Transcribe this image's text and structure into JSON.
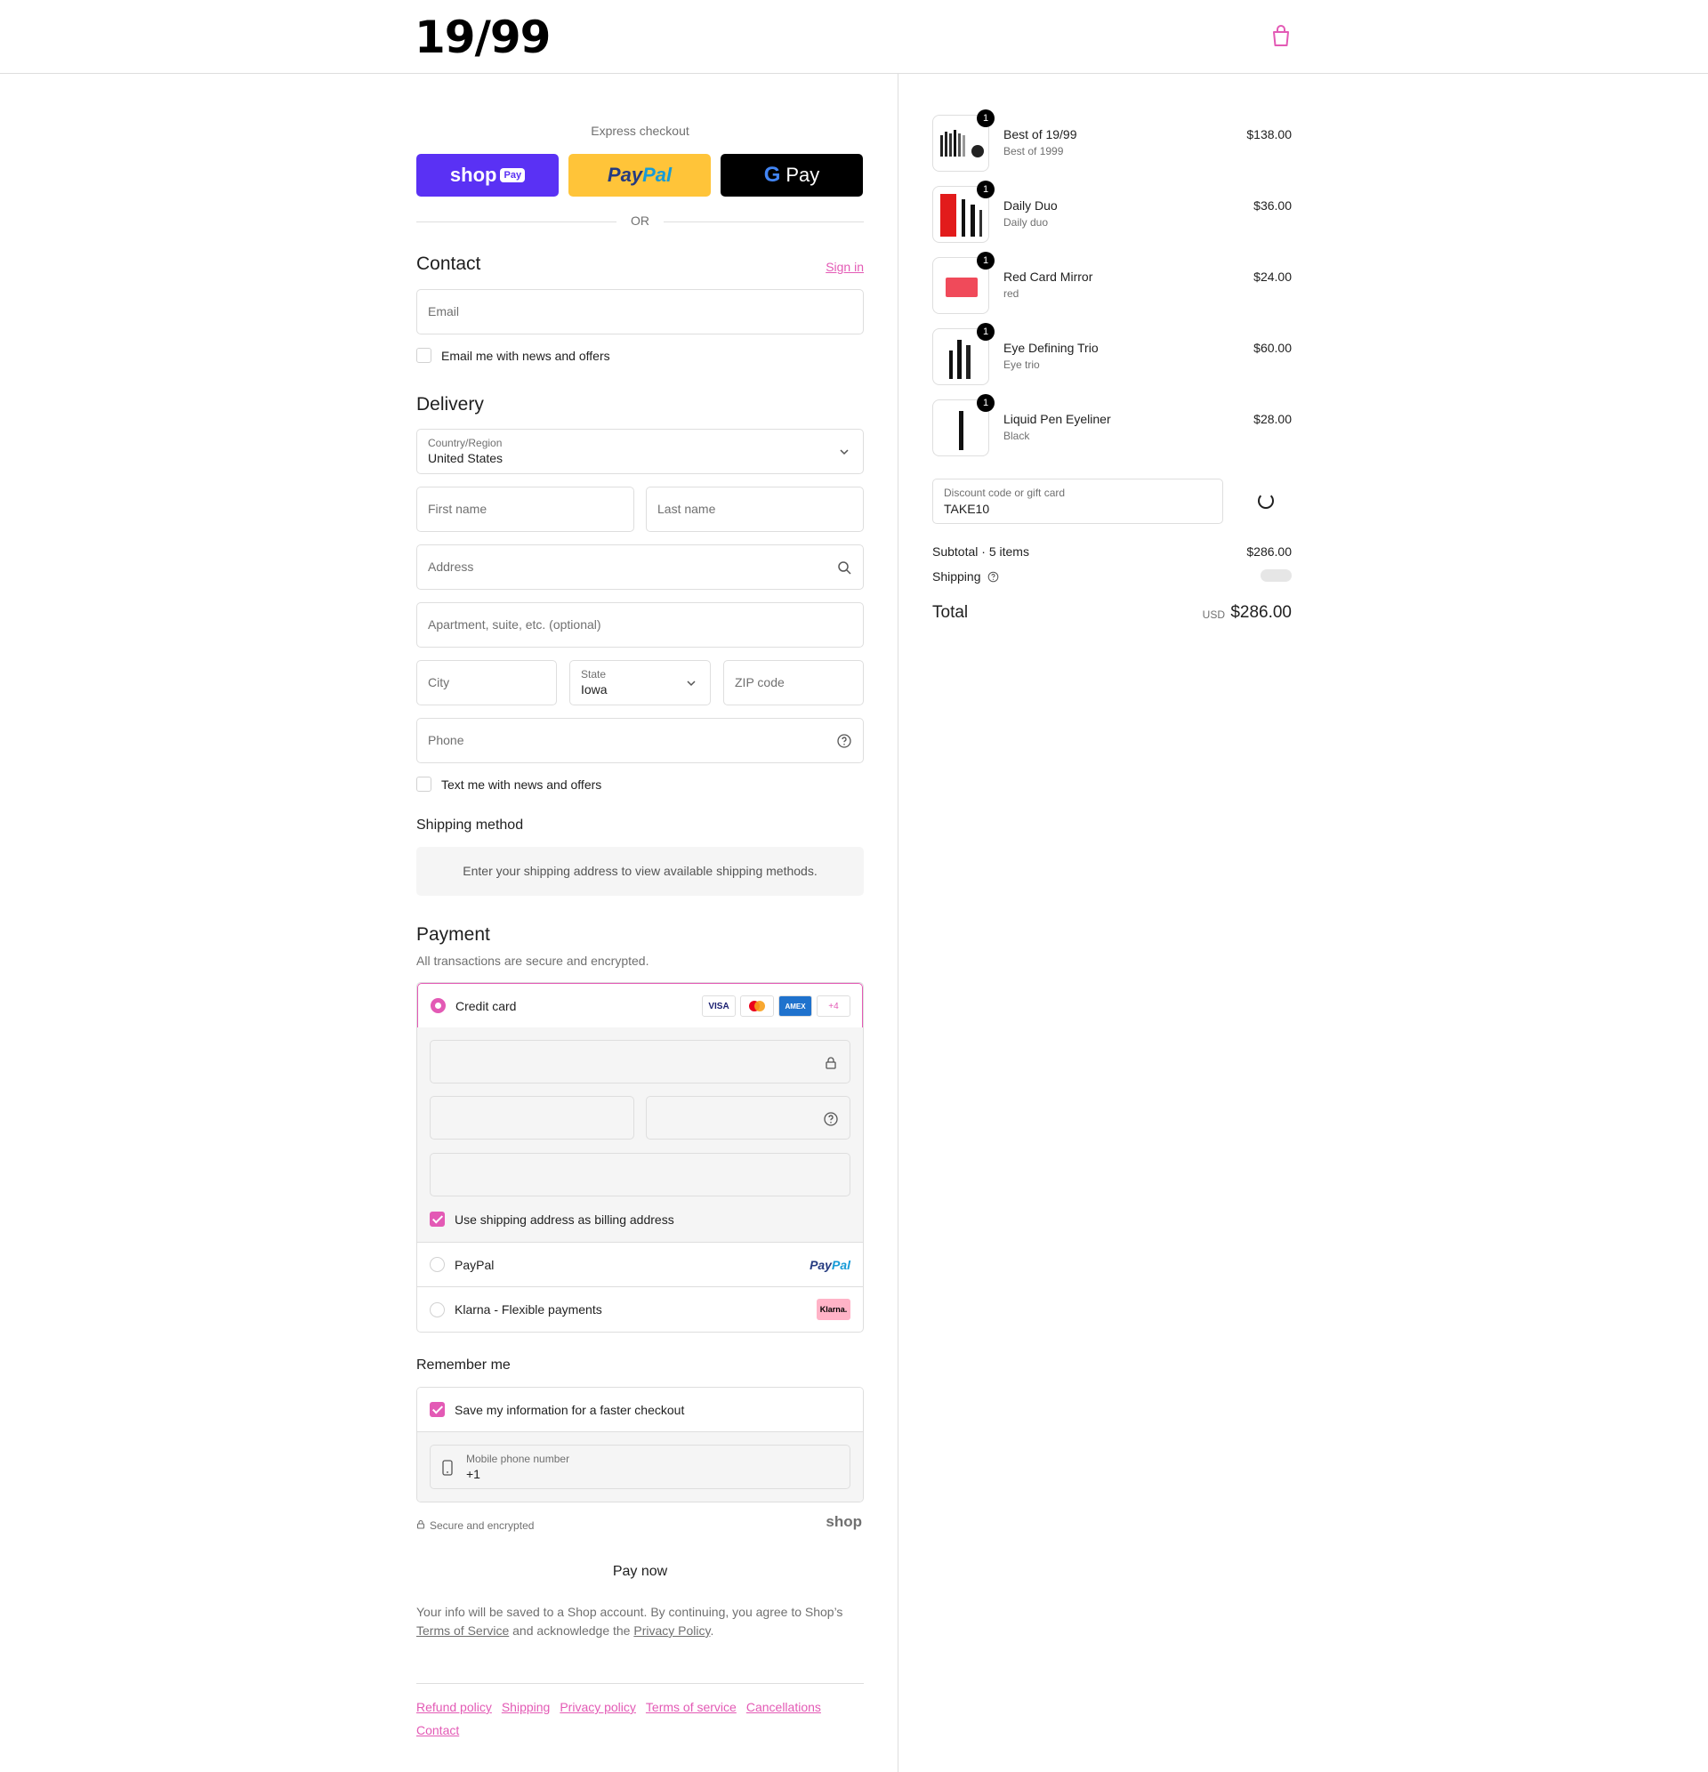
{
  "brand": {
    "logo": "19/99"
  },
  "express": {
    "label": "Express checkout",
    "shop_pay": {
      "word": "shop",
      "pill": "Pay"
    },
    "paypal": {
      "a": "Pay",
      "b": "Pal"
    },
    "gpay": {
      "g": "G",
      "word": "Pay"
    },
    "or": "OR"
  },
  "contact": {
    "title": "Contact",
    "signin": "Sign in",
    "email_placeholder": "Email",
    "news_label": "Email me with news and offers"
  },
  "delivery": {
    "title": "Delivery",
    "country_label": "Country/Region",
    "country_value": "United States",
    "first_name": "First name",
    "last_name": "Last name",
    "address": "Address",
    "apartment": "Apartment, suite, etc. (optional)",
    "city": "City",
    "state_label": "State",
    "state_value": "Iowa",
    "zip": "ZIP code",
    "phone": "Phone",
    "sms_label": "Text me with news and offers"
  },
  "shipping_method": {
    "title": "Shipping method",
    "info": "Enter your shipping address to view available shipping methods."
  },
  "payment": {
    "title": "Payment",
    "desc": "All transactions are secure and encrypted.",
    "credit_card": "Credit card",
    "brands": [
      "VISA",
      "MC",
      "AMEX",
      "+4"
    ],
    "billing_label": "Use shipping address as billing address",
    "paypal_label": "PayPal",
    "paypal_logo_a": "Pay",
    "paypal_logo_b": "Pal",
    "klarna_label": "Klarna - Flexible payments",
    "klarna_logo": "Klarna."
  },
  "remember": {
    "title": "Remember me",
    "save_label": "Save my information for a faster checkout",
    "mobile_label": "Mobile phone number",
    "mobile_value": "+1"
  },
  "secure_text": "Secure and encrypted",
  "shop_mark": "shop",
  "pay_now": "Pay now",
  "legal": {
    "text1": "Your info will be saved to a Shop account. By continuing, you agree to Shop’s ",
    "terms": "Terms of Service",
    "text2": " and acknowledge the ",
    "privacy": "Privacy Policy",
    "text3": "."
  },
  "footer_links": [
    "Refund policy",
    "Shipping",
    "Privacy policy",
    "Terms of service",
    "Cancellations",
    "Contact"
  ],
  "order": {
    "items": [
      {
        "name": "Best of 19/99",
        "variant": "Best of 1999",
        "price": "$138.00",
        "qty": "1"
      },
      {
        "name": "Daily Duo",
        "variant": "Daily duo",
        "price": "$36.00",
        "qty": "1"
      },
      {
        "name": "Red Card Mirror",
        "variant": "red",
        "price": "$24.00",
        "qty": "1"
      },
      {
        "name": "Eye Defining Trio",
        "variant": "Eye trio",
        "price": "$60.00",
        "qty": "1"
      },
      {
        "name": "Liquid Pen Eyeliner",
        "variant": "Black",
        "price": "$28.00",
        "qty": "1"
      }
    ],
    "discount_label": "Discount code or gift card",
    "discount_value": "TAKE10",
    "subtotal_label": "Subtotal · 5 items",
    "subtotal_value": "$286.00",
    "shipping_label": "Shipping",
    "total_label": "Total",
    "currency": "USD",
    "total_value": "$286.00"
  },
  "colors": {
    "accent": "#e35ab5",
    "shop_pay": "#5a31f4",
    "paypal": "#ffc439"
  }
}
